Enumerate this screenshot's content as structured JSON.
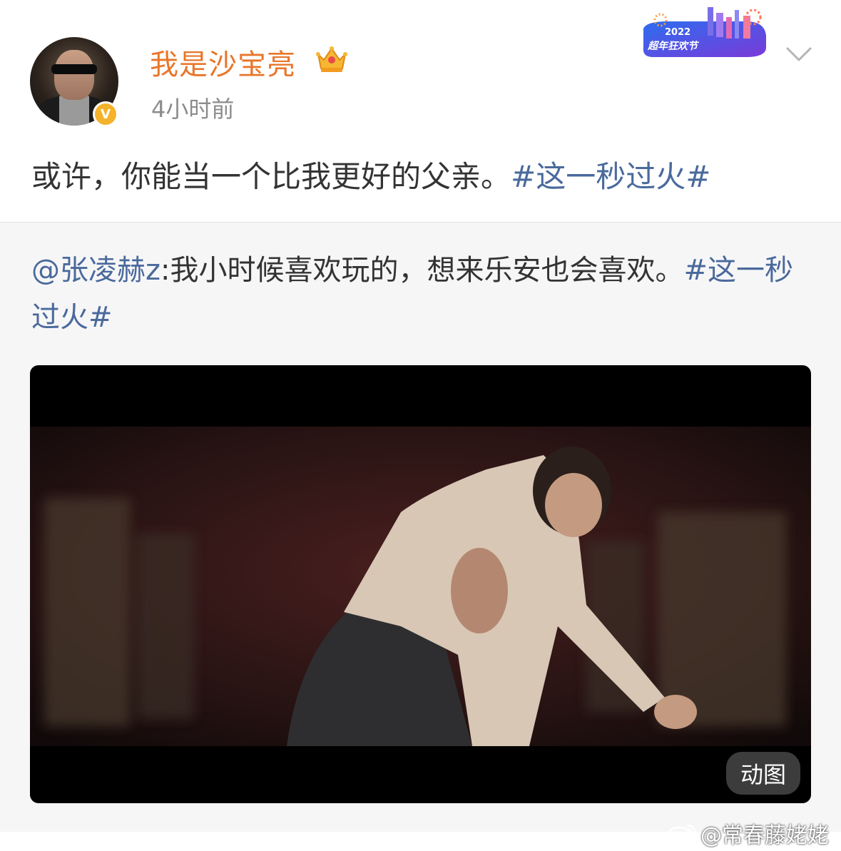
{
  "post": {
    "username": "我是沙宝亮",
    "timestamp": "4小时前",
    "verified_label": "V",
    "text": "或许，你能当一个比我更好的父亲。",
    "hashtag": "#这一秒过火#"
  },
  "festival_badge": {
    "year": "2022",
    "name": "超年狂欢节"
  },
  "repost": {
    "mention": "@张凌赫z",
    "text": ":我小时候喜欢玩的，想来乐安也会喜欢。",
    "hashtag": "#这一秒过火#"
  },
  "media": {
    "badge_label": "动图"
  },
  "watermark": {
    "text": "@常春藤姥姥"
  },
  "colors": {
    "username": "#e8762b",
    "hashtag": "#4a6a9c",
    "verified": "#f5b32b",
    "repost_bg": "#f7f6f7"
  },
  "icons": [
    "crown-icon",
    "chevron-down-icon",
    "verified-icon",
    "weibo-logo-icon"
  ]
}
